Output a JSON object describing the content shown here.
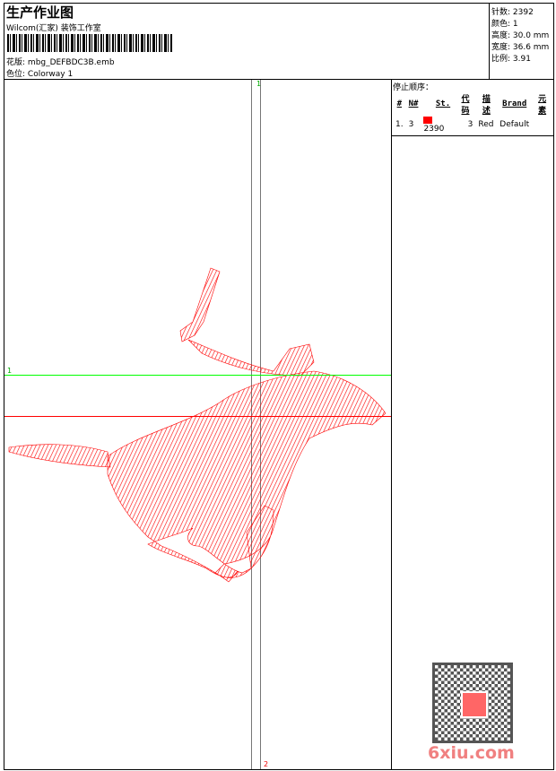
{
  "header": {
    "title": "生产作业图",
    "company": "Wilcom(汇家) 装饰工作室",
    "design_label": "花版:",
    "design_value": "mbg_DEFBDC3B.emb",
    "colorway_label": "色位:",
    "colorway_value": "Colorway 1"
  },
  "info": {
    "stitches": "针数: 2392",
    "colors": "颜色: 1",
    "height": "高度: 30.0 mm",
    "width": "宽度: 36.6 mm",
    "scale": "比例: 3.91"
  },
  "stop_sequence": {
    "title": "停止顺序：",
    "columns": [
      "#",
      "N#",
      "St.",
      "代码",
      "描述",
      "Brand",
      "元素"
    ],
    "rows": [
      {
        "index": "1.",
        "n": "3",
        "color": "#ff0000",
        "stitches": "2390",
        "code": "3",
        "desc": "Red",
        "brand": "Default"
      }
    ]
  },
  "guides": {
    "v_top": "1",
    "v_bottom": "2",
    "h_left": "1",
    "green": "#00ff00",
    "red": "#ff0000"
  },
  "embroidery_color": "#ff0000",
  "watermark": {
    "site": "6xiu.com",
    "seal": "以图版"
  }
}
